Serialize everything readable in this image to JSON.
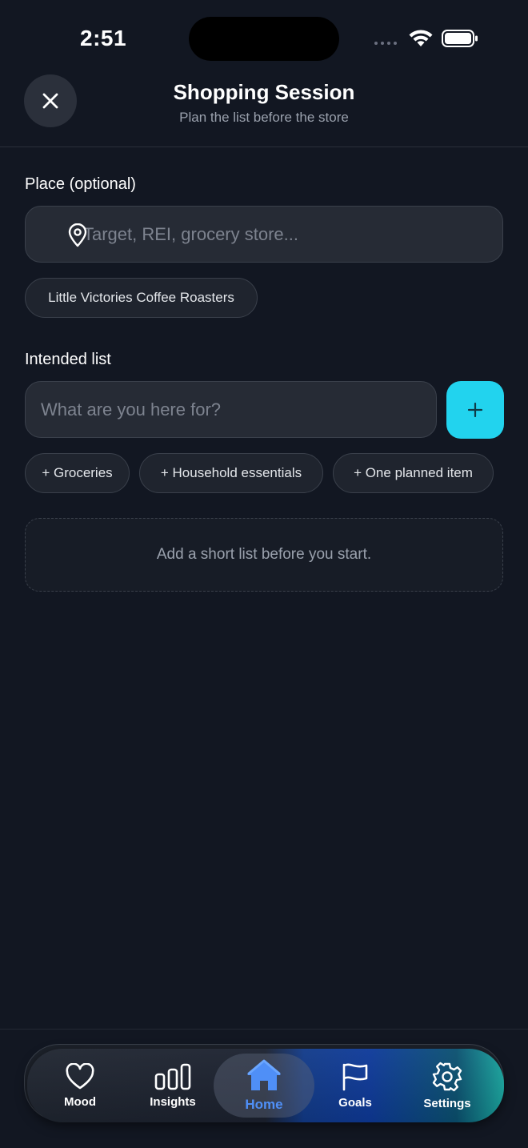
{
  "status_bar": {
    "time": "2:51"
  },
  "header": {
    "title": "Shopping Session",
    "subtitle": "Plan the list before the store"
  },
  "place": {
    "label": "Place (optional)",
    "placeholder": "Target, REI, grocery store...",
    "value": "",
    "suggestion": "Little Victories Coffee Roasters"
  },
  "intended_list": {
    "label": "Intended list",
    "placeholder": "What are you here for?",
    "value": "",
    "quick_adds": [
      "+ Groceries",
      "+ Household essentials",
      "+ One planned item"
    ],
    "empty_message": "Add a short list before you start."
  },
  "tab_bar": {
    "items": [
      {
        "label": "Mood",
        "icon": "heart-icon"
      },
      {
        "label": "Insights",
        "icon": "bar-chart-icon"
      },
      {
        "label": "Home",
        "icon": "home-icon"
      },
      {
        "label": "Goals",
        "icon": "flag-icon"
      },
      {
        "label": "Settings",
        "icon": "gear-icon"
      }
    ],
    "active": "Home"
  },
  "colors": {
    "background": "#121722",
    "accent": "#22d3ee",
    "active_tab": "#4f8ff7"
  }
}
